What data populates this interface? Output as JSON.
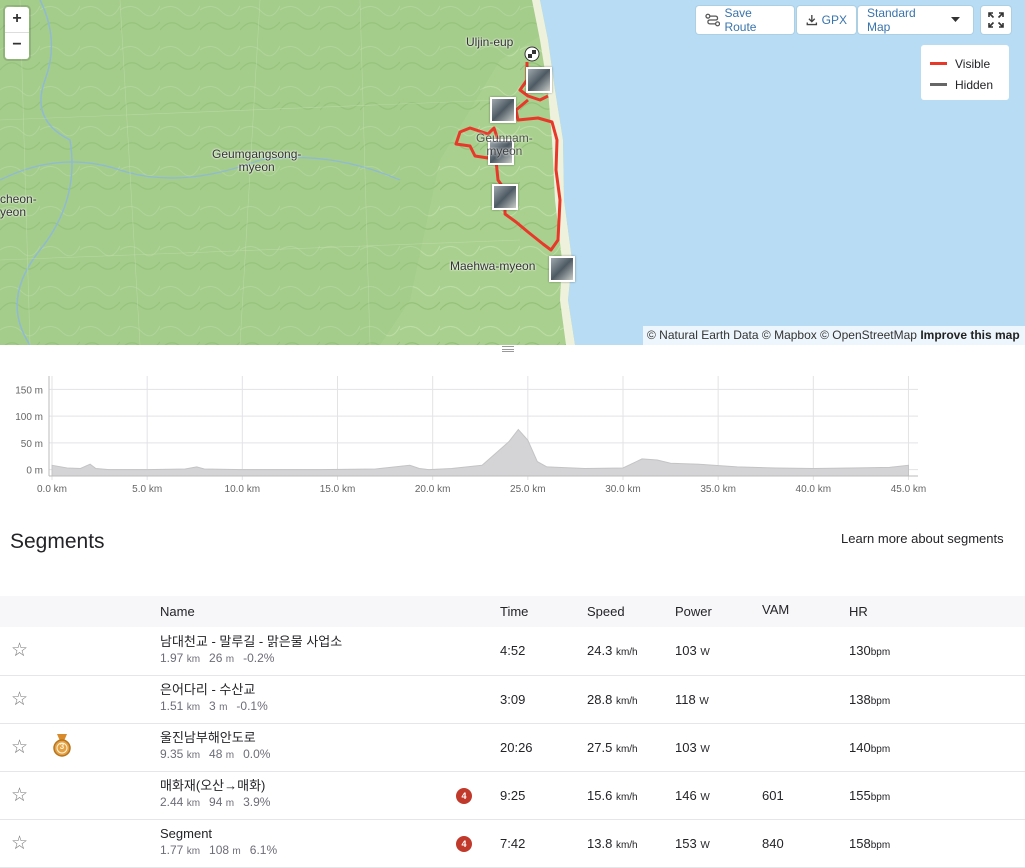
{
  "map": {
    "zoom_in": "+",
    "zoom_out": "−",
    "toolbar": {
      "save_route": "Save Route",
      "gpx": "GPX",
      "map_style": "Standard Map"
    },
    "legend": [
      {
        "label": "Visible",
        "color": "#fc4c02"
      },
      {
        "label": "Hidden",
        "color": "#666666"
      }
    ],
    "place_labels": [
      "Uljin-eup",
      "Geumgangsong-\nmyeon",
      "cheon-\nyeon",
      "Maehwa-myeon",
      "Geunnam-\nmyeon"
    ],
    "attribution": {
      "text": "© Natural Earth Data © Mapbox © OpenStreetMap",
      "link": "Improve this map"
    },
    "colors": {
      "land": "#a9d08e",
      "water": "#b7dcf3",
      "route": "#e8382a"
    }
  },
  "elevation": {
    "y_ticks": [
      "150 m",
      "100 m",
      "50 m",
      "0 m"
    ],
    "x_ticks": [
      "0.0 km",
      "5.0 km",
      "10.0 km",
      "15.0 km",
      "20.0 km",
      "25.0 km",
      "30.0 km",
      "35.0 km",
      "40.0 km",
      "45.0 km"
    ]
  },
  "chart_data": {
    "type": "area",
    "xlabel": "",
    "ylabel": "",
    "xlim": [
      0,
      45.5
    ],
    "ylim": [
      -12,
      175
    ],
    "x_unit": "km",
    "y_unit": "m",
    "x": [
      0,
      0.8,
      1.5,
      2.0,
      2.3,
      3.0,
      5.0,
      7.0,
      7.6,
      8.0,
      10,
      14,
      17,
      18.8,
      19.3,
      19.8,
      21,
      22.6,
      23.3,
      24.0,
      24.5,
      25.0,
      25.5,
      26.0,
      28,
      30,
      31.0,
      31.8,
      32.5,
      34,
      36,
      38,
      40,
      42,
      44,
      45.0
    ],
    "y": [
      8,
      3,
      2,
      10,
      2,
      0,
      0,
      1,
      5,
      1,
      0,
      0,
      1,
      8,
      2,
      0,
      2,
      8,
      30,
      52,
      75,
      55,
      15,
      5,
      2,
      3,
      20,
      18,
      12,
      10,
      5,
      3,
      2,
      3,
      4,
      8
    ],
    "series": [
      {
        "values": [
          8,
          3,
          2,
          10,
          2,
          0,
          0,
          1,
          5,
          1,
          0,
          0,
          1,
          8,
          2,
          0,
          2,
          8,
          30,
          52,
          75,
          55,
          15,
          5,
          2,
          3,
          20,
          18,
          12,
          10,
          5,
          3,
          2,
          3,
          4,
          8
        ]
      }
    ],
    "grid": true
  },
  "segments": {
    "title": "Segments",
    "learn_more": "Learn more about segments",
    "columns": [
      "Name",
      "Time",
      "Speed",
      "Power",
      "VAM",
      "HR"
    ],
    "rows": [
      {
        "name": "남대천교 - 말루길 - 맑은물 사업소",
        "dist": "1.97",
        "dist_u": "km",
        "elev": "26",
        "elev_u": "m",
        "grade": "-0.2%",
        "medal": "",
        "cat": "",
        "time": "4:52",
        "speed": "24.3",
        "speed_u": "km/h",
        "power": "103",
        "power_u": "W",
        "vam": "",
        "hr": "130",
        "hr_u": "bpm"
      },
      {
        "name": "은어다리 - 수산교",
        "dist": "1.51",
        "dist_u": "km",
        "elev": "3",
        "elev_u": "m",
        "grade": "-0.1%",
        "medal": "",
        "cat": "",
        "time": "3:09",
        "speed": "28.8",
        "speed_u": "km/h",
        "power": "118",
        "power_u": "W",
        "vam": "",
        "hr": "138",
        "hr_u": "bpm"
      },
      {
        "name": "울진남부해안도로",
        "dist": "9.35",
        "dist_u": "km",
        "elev": "48",
        "elev_u": "m",
        "grade": "0.0%",
        "medal": "3",
        "cat": "",
        "time": "20:26",
        "speed": "27.5",
        "speed_u": "km/h",
        "power": "103",
        "power_u": "W",
        "vam": "",
        "hr": "140",
        "hr_u": "bpm"
      },
      {
        "name": "매화재(오산→매화)",
        "dist": "2.44",
        "dist_u": "km",
        "elev": "94",
        "elev_u": "m",
        "grade": "3.9%",
        "medal": "",
        "cat": "4",
        "time": "9:25",
        "speed": "15.6",
        "speed_u": "km/h",
        "power": "146",
        "power_u": "W",
        "vam": "601",
        "hr": "155",
        "hr_u": "bpm"
      },
      {
        "name": "Segment",
        "dist": "1.77",
        "dist_u": "km",
        "elev": "108",
        "elev_u": "m",
        "grade": "6.1%",
        "medal": "",
        "cat": "4",
        "time": "7:42",
        "speed": "13.8",
        "speed_u": "km/h",
        "power": "153",
        "power_u": "W",
        "vam": "840",
        "hr": "158",
        "hr_u": "bpm"
      }
    ]
  }
}
